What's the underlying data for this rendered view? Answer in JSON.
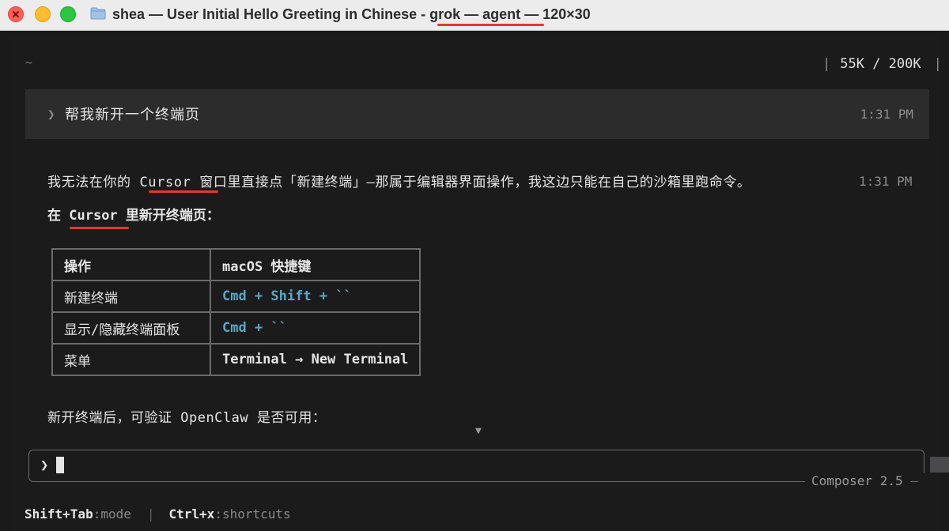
{
  "window": {
    "title": "shea — User Initial Hello Greeting in Chinese - grok — agent — 120×30"
  },
  "header": {
    "cwd": "~",
    "tokens": "55K / 200K"
  },
  "user_message": {
    "text": "帮我新开一个终端页",
    "time": "1:31 PM"
  },
  "reply": {
    "line1_pre": "我无法在你的 ",
    "line1_cursor": "Cursor",
    "line1_post": " 窗口里直接点「新建终端」—那属于编辑器界面操作，我这边只能在自己的沙箱里跑命令。",
    "time": "1:31 PM",
    "line2_pre": "在 ",
    "line2_cursor": "Cursor",
    "line2_post": " 里新开终端页：",
    "table": {
      "headers": [
        "操作",
        "macOS 快捷键"
      ],
      "rows": [
        [
          "新建终端",
          "Cmd + Shift + ``"
        ],
        [
          "显示/隐藏终端面板",
          "Cmd + ``"
        ],
        [
          "菜单",
          "Terminal → New Terminal"
        ]
      ]
    },
    "after": "新开终端后，可验证 OpenClaw 是否可用："
  },
  "input": {
    "prompt": "❯",
    "model": "Composer 2.5"
  },
  "footer": {
    "mode_key": "Shift+Tab",
    "mode_label": ":mode",
    "shortcuts_key": "Ctrl+x",
    "shortcuts_label": ":shortcuts"
  },
  "icons": {
    "folder": "folder-icon",
    "scroll_down": "chevron-down-icon"
  },
  "colors": {
    "accent_underline": "#e23a2a",
    "key_blue": "#59a7c8"
  }
}
